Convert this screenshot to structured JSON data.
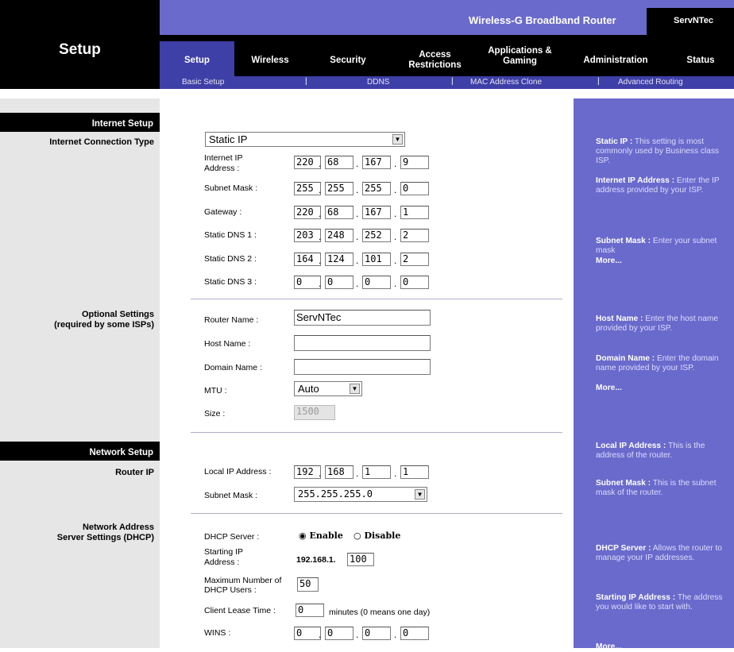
{
  "header": {
    "section_title": "Setup",
    "product_name": "Wireless-G Broadband Router",
    "model": "ServNTec"
  },
  "tabs": [
    {
      "label": "Setup"
    },
    {
      "label": "Wireless"
    },
    {
      "label": "Security"
    },
    {
      "label": "Access Restrictions"
    },
    {
      "label": "Applications & Gaming"
    },
    {
      "label": "Administration"
    },
    {
      "label": "Status"
    }
  ],
  "subtabs": [
    "Basic Setup",
    "DDNS",
    "MAC Address Clone",
    "Advanced Routing"
  ],
  "sections": {
    "internet_setup": "Internet Setup",
    "internet_connection_type": "Internet Connection Type",
    "optional_settings": "Optional Settings",
    "optional_settings_note": "(required by some ISPs)",
    "network_setup": "Network Setup",
    "router_ip": "Router IP",
    "dhcp_1": "Network Address",
    "dhcp_2": "Server Settings (DHCP)"
  },
  "connection_type": "Static IP",
  "static": {
    "ip_label_1": "Internet IP",
    "ip_label_2": "Address :",
    "ip": [
      "220",
      "68",
      "167",
      "9"
    ],
    "mask_label": "Subnet Mask :",
    "mask": [
      "255",
      "255",
      "255",
      "0"
    ],
    "gateway_label": "Gateway :",
    "gateway": [
      "220",
      "68",
      "167",
      "1"
    ],
    "dns1_label": "Static DNS 1 :",
    "dns1": [
      "203",
      "248",
      "252",
      "2"
    ],
    "dns2_label": "Static DNS 2 :",
    "dns2": [
      "164",
      "124",
      "101",
      "2"
    ],
    "dns3_label": "Static DNS 3 :",
    "dns3": [
      "0",
      "0",
      "0",
      "0"
    ]
  },
  "optional": {
    "router_name_label": "Router Name :",
    "router_name": "ServNTec",
    "host_name_label": "Host Name :",
    "host_name": "",
    "domain_name_label": "Domain Name :",
    "domain_name": "",
    "mtu_label": "MTU :",
    "mtu": "Auto",
    "size_label": "Size :",
    "size": "1500"
  },
  "router": {
    "local_ip_label": "Local IP Address :",
    "local_ip": [
      "192",
      "168",
      "1",
      "1"
    ],
    "mask_label": "Subnet Mask :",
    "mask": "255.255.255.0"
  },
  "dhcp": {
    "server_label": "DHCP Server :",
    "enable": "Enable",
    "disable": "Disable",
    "start_label_1": "Starting IP",
    "start_label_2": "Address :",
    "start_prefix": "192.168.1.",
    "start_value": "100",
    "max_label_1": "Maximum Number of",
    "max_label_2": "DHCP Users :",
    "max_value": "50",
    "lease_label": "Client Lease Time :",
    "lease_value": "0",
    "lease_note": "minutes (0 means one day)",
    "wins_label": "WINS :",
    "wins": [
      "0",
      "0",
      "0",
      "0"
    ]
  },
  "help": {
    "h1_title": "Static IP :",
    "h1_text": "This setting is most commonly used by Business class ISP.",
    "h2_title": "Internet IP Address :",
    "h2_text": "Enter the IP address provided by your ISP.",
    "h3_title": "Subnet Mask :",
    "h3_text": "Enter your subnet mask",
    "more": "More...",
    "h4_title": "Host Name :",
    "h4_text": "Enter the host name provided by your ISP.",
    "h5_title": "Domain Name :",
    "h5_text": "Enter the domain name provided by your ISP.",
    "h6_title": "Local IP Address :",
    "h6_text": "This is the address of the router.",
    "h7_title": "Subnet Mask :",
    "h7_text": "This is the subnet mask of the router.",
    "h8_title": "DHCP Server :",
    "h8_text": "Allows the router to manage your IP addresses.",
    "h9_title": "Starting IP Address :",
    "h9_text": "The address you would like to start with.",
    "more_cut": "More..."
  },
  "colors": {
    "accent": "#6a6acc",
    "tab_active": "#3f3fa8",
    "header_black": "#000000",
    "left_gray": "#e6e6e6"
  }
}
